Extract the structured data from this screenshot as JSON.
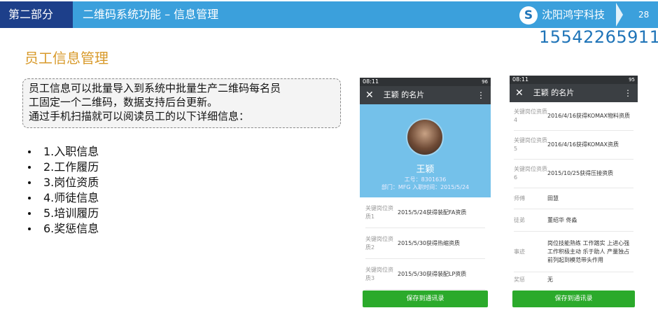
{
  "header": {
    "part": "第二部分",
    "title": "二维码系统功能 – 信息管理",
    "company": "沈阳鸿宇科技",
    "logo_glyph": "S",
    "page": "28"
  },
  "phone_number": "15542265911",
  "section_title": "员工信息管理",
  "callout_lines": [
    "员工信息可以批量导入到系统中批量生产二维码每名员",
    "工固定一个二维码，数据支持后台更新。",
    "通过手机扫描就可以阅读员工的以下详细信息："
  ],
  "bullets": [
    "1.入职信息",
    "2.工作履历",
    "3.岗位资质",
    "4.师徒信息",
    "5.培训履历",
    "6.奖惩信息"
  ],
  "phone1": {
    "time": "08:11",
    "status_right": "96",
    "close_glyph": "✕",
    "title": "王颖 的名片",
    "more_glyph": "⋮",
    "name": "王颖",
    "id_line": "工号：8301636",
    "dept_line": "部门：MFG 入职时间：2015/5/24",
    "rows": [
      {
        "key": "关键岗位资质1",
        "value": "2015/5/24获得装配FA资质"
      },
      {
        "key": "关键岗位资质2",
        "value": "2015/5/30获得热缩资质"
      },
      {
        "key": "关键岗位资质3",
        "value": "2015/5/30获得装配LP资质"
      }
    ],
    "save": "保存到通讯录"
  },
  "phone2": {
    "time": "08:11",
    "status_right": "95",
    "close_glyph": "✕",
    "title": "王颖 的名片",
    "more_glyph": "⋮",
    "rows": [
      {
        "key": "关键岗位资质4",
        "value": "2016/4/16获得KOMAX物料资质"
      },
      {
        "key": "关键岗位资质5",
        "value": "2016/4/16获得KOMAX资质"
      },
      {
        "key": "关键岗位资质6",
        "value": "2015/10/25获得压接资质"
      },
      {
        "key": "师傅",
        "value": "田慧"
      },
      {
        "key": "徒弟",
        "value": "董绍华 佟淼"
      },
      {
        "key": "事迹",
        "value": "岗位技能熟练 工作踏实 上进心强 工作积极主动 乐于助人 产量独占前列起到模范带头作用"
      },
      {
        "key": "奖惩",
        "value": "无"
      }
    ],
    "save": "保存到通讯录"
  }
}
